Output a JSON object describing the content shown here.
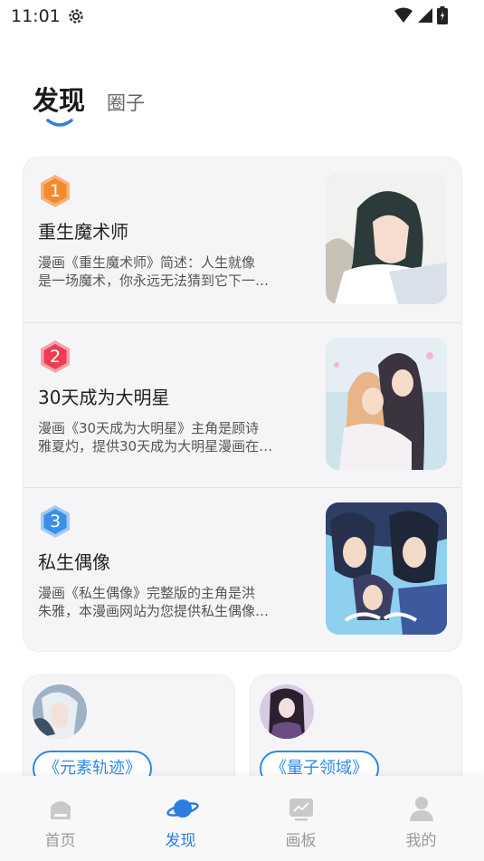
{
  "status_bar": {
    "time": "11:01"
  },
  "tabs": {
    "active": "发现",
    "inactive": "圈子"
  },
  "ranking": [
    {
      "rank": "1",
      "badge_color": "#f28a2e",
      "title": "重生魔术师",
      "desc_line1": "漫画《重生魔术师》简述：人生就像",
      "desc_line2": "是一场魔术，你永远无法猜到它下一…"
    },
    {
      "rank": "2",
      "badge_color": "#ee3d52",
      "title": "30天成为大明星",
      "desc_line1": "漫画《30天成为大明星》主角是顾诗",
      "desc_line2": "雅夏灼，提供30天成为大明星漫画在…"
    },
    {
      "rank": "3",
      "badge_color": "#3a8fe6",
      "title": "私生偶像",
      "desc_line1": "漫画《私生偶像》完整版的主角是洪",
      "desc_line2": "朱雅，本漫画网站为您提供私生偶像…"
    }
  ],
  "circles": [
    {
      "tag": "《元素轨迹》"
    },
    {
      "tag": "《量子领域》"
    }
  ],
  "bottom_nav": [
    {
      "label": "首页",
      "icon": "home-icon"
    },
    {
      "label": "发现",
      "icon": "planet-icon"
    },
    {
      "label": "画板",
      "icon": "board-icon"
    },
    {
      "label": "我的",
      "icon": "user-icon"
    }
  ],
  "colors": {
    "accent": "#2d7de0",
    "inactive": "#9a9a9a"
  }
}
